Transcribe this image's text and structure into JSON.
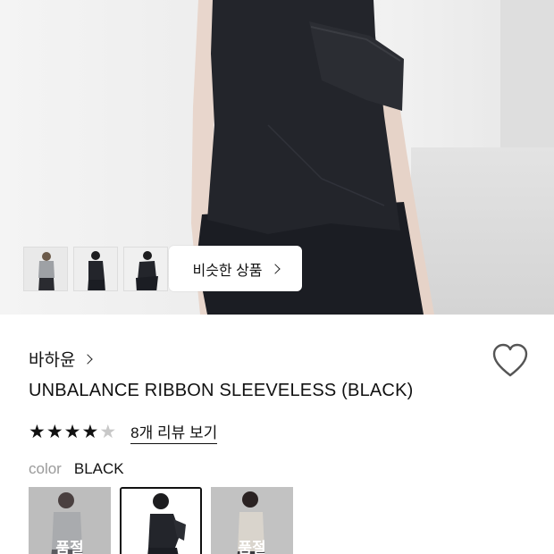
{
  "similar": {
    "label": "비슷한 상품"
  },
  "product": {
    "brand": "바하윤",
    "title": "UNBALANCE RIBBON SLEEVELESS (BLACK)",
    "rating": 4,
    "rating_max": 5,
    "review_link": "8개 리뷰 보기",
    "color_label": "color",
    "color_value": "BLACK"
  },
  "thumbnails": [
    {
      "icon": "gray-top-thumbnail"
    },
    {
      "icon": "black-top-thumbnail"
    },
    {
      "icon": "black-top-side-thumbnail"
    }
  ],
  "swatches": [
    {
      "color": "gray",
      "badge": "품절",
      "selected": false
    },
    {
      "color": "black",
      "badge": "",
      "selected": true
    },
    {
      "color": "beige",
      "badge": "품절",
      "selected": false
    }
  ],
  "icons": {
    "wishlist": "heart-outline-icon",
    "chevron": "chevron-right-icon",
    "star": "star-icon"
  },
  "colors": {
    "text": "#111111",
    "muted": "#9a9a9a",
    "star_off": "#c8c8c8",
    "garment": "#23252b"
  }
}
